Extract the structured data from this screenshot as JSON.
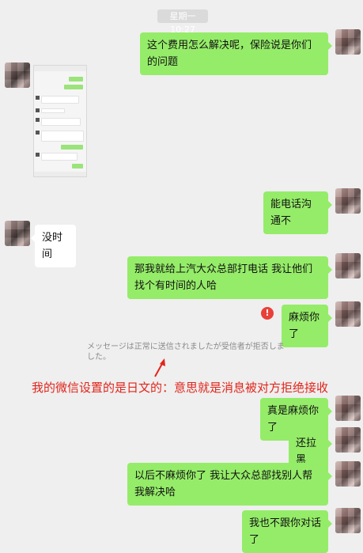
{
  "timestamp": "星期一 10:27",
  "messages": [
    {
      "text": "这个费用怎么解决呢，保险说是你们的问题"
    },
    {
      "text": "能电话沟通不"
    },
    {
      "text": "没时间"
    },
    {
      "text": "那我就给上汽大众总部打电话 我让他们找个有时间的人哈"
    },
    {
      "text": "麻烦你了"
    },
    {
      "text": "真是麻烦你了"
    },
    {
      "text": "还拉黑"
    },
    {
      "text": "以后不麻烦你了 我让大众总部找别人帮我解决哈"
    },
    {
      "text": "我也不跟你对话了"
    }
  ],
  "error_icon": {
    "glyph": "!",
    "color": "#e8413a"
  },
  "system_notice": "メッセージは正常に送信されましたが受信者が拒否しました。",
  "annotation": "我的微信设置的是日文的：意思就是消息被对方拒绝接收",
  "annotation_color": "#e1251b",
  "bubble_out_color": "#95ec69"
}
